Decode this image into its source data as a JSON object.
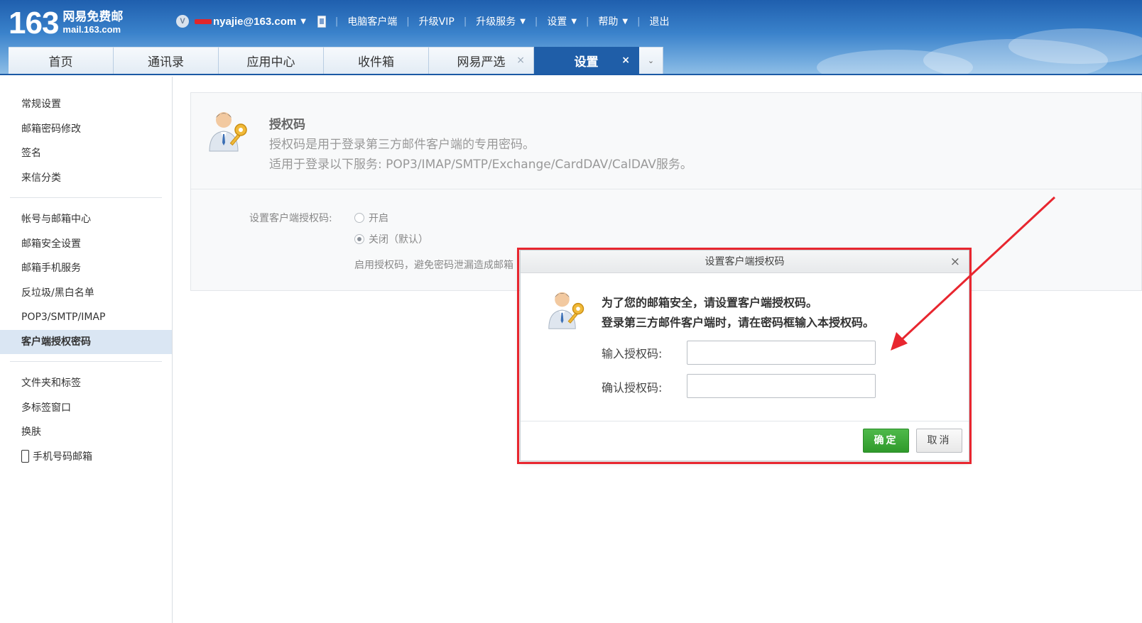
{
  "header": {
    "logo_number": "163",
    "logo_cn": "网易免费邮",
    "logo_url": "mail.163.com",
    "vip_badge": "V",
    "account": "nyajie@163.com",
    "nav": [
      "电脑客户端",
      "升级VIP",
      "升级服务",
      "设置",
      "帮助",
      "退出"
    ]
  },
  "tabs": [
    "首页",
    "通讯录",
    "应用中心",
    "收件箱",
    "网易严选",
    "设置"
  ],
  "tab_close": "×",
  "tab_more": "⌄",
  "sidebar": {
    "group1": [
      "常规设置",
      "邮箱密码修改",
      "签名",
      "来信分类"
    ],
    "group2": [
      "帐号与邮箱中心",
      "邮箱安全设置",
      "邮箱手机服务",
      "反垃圾/黑白名单",
      "POP3/SMTP/IMAP",
      "客户端授权密码"
    ],
    "group3": [
      "文件夹和标签",
      "多标签窗口",
      "换肤",
      "手机号码邮箱"
    ]
  },
  "card": {
    "title": "授权码",
    "desc1": "授权码是用于登录第三方邮件客户端的专用密码。",
    "desc2": "适用于登录以下服务: POP3/IMAP/SMTP/Exchange/CardDAV/CalDAV服务。",
    "field_label": "设置客户端授权码:",
    "option_on": "开启",
    "option_off": "关闭（默认）",
    "hint": "启用授权码，避免密码泄漏造成邮箱"
  },
  "dialog": {
    "title": "设置客户端授权码",
    "close": "×",
    "msg1": "为了您的邮箱安全，请设置客户端授权码。",
    "msg2": "登录第三方邮件客户端时，请在密码框输入本授权码。",
    "input_label": "输入授权码:",
    "confirm_label": "确认授权码:",
    "input_value": "",
    "confirm_value": "",
    "ok": "确定",
    "cancel": "取消"
  },
  "colors": {
    "header_blue": "#1f5ea8",
    "ok_green": "#3aa836",
    "annotation_red": "#e8262f"
  }
}
